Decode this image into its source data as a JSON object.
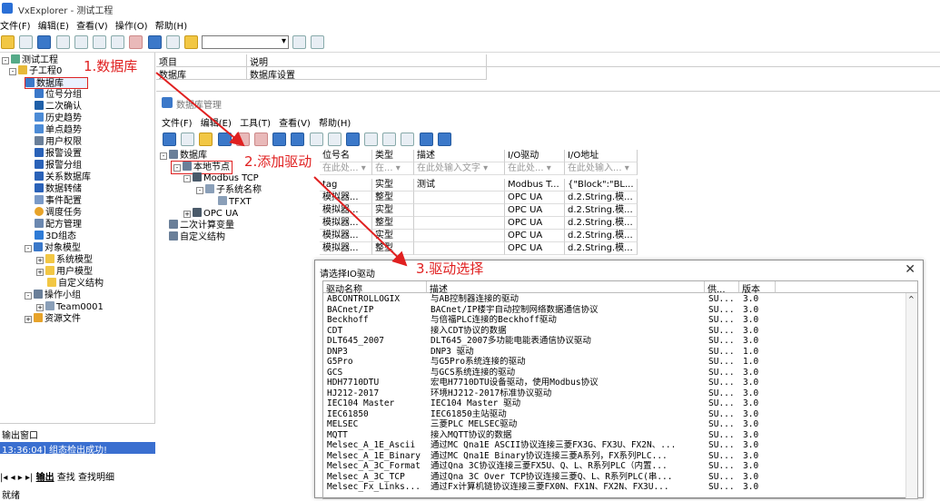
{
  "app": {
    "title": "VxExplorer - 测试工程"
  },
  "menu": [
    "文件(F)",
    "编辑(E)",
    "查看(V)",
    "操作(O)",
    "帮助(H)"
  ],
  "tree": {
    "root": "测试工程",
    "project": "子工程0",
    "items": [
      "数据库",
      "位号分组",
      "二次确认",
      "历史趋势",
      "单点趋势",
      "用户权限",
      "报警设置",
      "报警分组",
      "关系数据库",
      "数据转储",
      "事件配置",
      "调度任务",
      "配方管理",
      "3D组态"
    ],
    "object_model": "对象模型",
    "object_children": [
      "系统模型",
      "用户模型",
      "自定义结构"
    ],
    "op_group": "操作小组",
    "team": "Team0001",
    "resources": "资源文件"
  },
  "annotations": {
    "step1": "1.数据库",
    "step2": "2.添加驱动",
    "step3": "3.驱动选择"
  },
  "top_grid": {
    "headers": [
      "项目",
      "说明"
    ],
    "row": [
      "数据库",
      "数据库设置"
    ]
  },
  "db_window": {
    "title": "数据库管理",
    "menu": [
      "文件(F)",
      "编辑(E)",
      "工具(T)",
      "查看(V)",
      "帮助(H)"
    ],
    "tree": [
      "数据库",
      "本地节点",
      "Modbus TCP",
      "子系统名称",
      "TFXT",
      "OPC UA",
      "二次计算变量",
      "自定义结构"
    ],
    "table_headers": [
      "位号名",
      "类型",
      "描述",
      "I/O驱动",
      "I/O地址"
    ],
    "filters": [
      "在此处...",
      "在...",
      "在此处输入文字",
      "在此处...",
      "在此处输入..."
    ],
    "rows": [
      [
        "tag",
        "实型",
        "测试",
        "Modbus T...",
        "{\"Block\":\"BL..."
      ],
      [
        "模拟器...",
        "整型",
        "",
        "OPC UA",
        "d.2.String.模..."
      ],
      [
        "模拟器...",
        "实型",
        "",
        "OPC UA",
        "d.2.String.模..."
      ],
      [
        "模拟器...",
        "整型",
        "",
        "OPC UA",
        "d.2.String.模..."
      ],
      [
        "模拟器...",
        "实型",
        "",
        "OPC UA",
        "d.2.String.模..."
      ],
      [
        "模拟器...",
        "整型",
        "",
        "OPC UA",
        "d.2.String.模..."
      ]
    ]
  },
  "dialog": {
    "title": "请选择IO驱动",
    "close": "✕",
    "headers": [
      "驱动名称",
      "描述",
      "供...",
      "版本"
    ],
    "rows": [
      [
        "ABCONTROLLOGIX",
        "与AB控制器连接的驱动",
        "SU...",
        "3.0"
      ],
      [
        "BACnet/IP",
        "BACnet/IP楼宇自动控制网络数据通信协议",
        "SU...",
        "3.0"
      ],
      [
        "Beckhoff",
        "与倍福PLC连接的Beckhoff驱动",
        "SU...",
        "3.0"
      ],
      [
        "CDT",
        "接入CDT协议的数据",
        "SU...",
        "3.0"
      ],
      [
        "DLT645_2007",
        "DLT645_2007多功能电能表通信协议驱动",
        "SU...",
        "3.0"
      ],
      [
        "DNP3",
        "DNP3 驱动",
        "SU...",
        "1.0"
      ],
      [
        "G5Pro",
        "与G5Pro系统连接的驱动",
        "SU...",
        "1.0"
      ],
      [
        "GCS",
        "与GCS系统连接的驱动",
        "SU...",
        "3.0"
      ],
      [
        "HDH7710DTU",
        "宏电H7710DTU设备驱动，使用Modbus协议",
        "SU...",
        "3.0"
      ],
      [
        "HJ212-2017",
        "环境HJ212-2017标准协议驱动",
        "SU...",
        "3.0"
      ],
      [
        "IEC104 Master",
        "IEC104 Master 驱动",
        "SU...",
        "3.0"
      ],
      [
        "IEC61850",
        "IEC61850主站驱动",
        "SU...",
        "3.0"
      ],
      [
        "MELSEC",
        "三菱PLC MELSEC驱动",
        "SU...",
        "3.0"
      ],
      [
        "MQTT",
        "接入MQTT协议的数据",
        "SU...",
        "3.0"
      ],
      [
        "Melsec_A_1E_Ascii",
        "通过MC Qna1E ASCII协议连接三菱FX3G、FX3U、FX2N、...",
        "SU...",
        "3.0"
      ],
      [
        "Melsec_A_1E_Binary",
        "通过MC Qna1E Binary协议连接三菱A系列，FX系列PLC...",
        "SU...",
        "3.0"
      ],
      [
        "Melsec_A_3C_Format",
        "通过Qna 3C协议连接三菱FX5U、Q、L、R系列PLC（内置...",
        "SU...",
        "3.0"
      ],
      [
        "Melsec_A_3C_TCP",
        "通过Qna 3C Over TCP协议连接三菱Q、L、R系列PLC(串...",
        "SU...",
        "3.0"
      ],
      [
        "Melsec_Fx_Links...",
        "通过Fx计算机链协议连接三菱FX0N、FX1N、FX2N、FX3U...",
        "SU...",
        "3.0"
      ]
    ]
  },
  "output": {
    "title": "输出窗口",
    "log": "13:36:04] 组态检出成功!",
    "tabs": [
      "输出",
      "查找",
      "查找明细"
    ],
    "status": "就绪"
  },
  "colors": {
    "annotation": "#e02020",
    "selection": "#3a6fd0"
  }
}
